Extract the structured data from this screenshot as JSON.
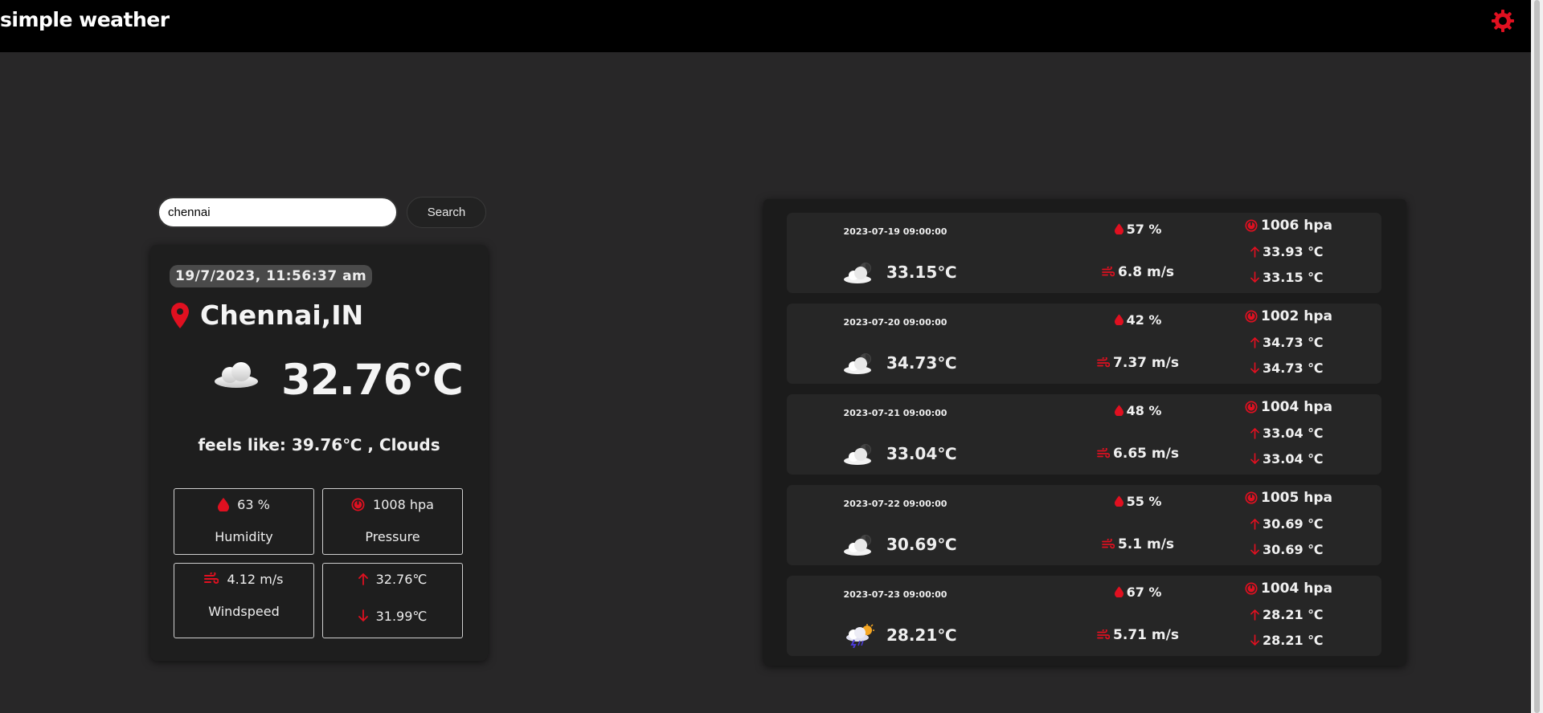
{
  "app": {
    "title": "simple weather",
    "accent_color": "#e01020",
    "settings_icon": "gear-icon"
  },
  "search": {
    "value": "chennai",
    "button_label": "Search"
  },
  "current": {
    "datetime": "19/7/2023, 11:56:37 am",
    "city": "Chennai,IN",
    "icon": "cloud-icon",
    "temperature": "32.76℃",
    "feels_like": "feels like: 39.76℃ , Clouds",
    "humidity": {
      "value": "63 %",
      "label": "Humidity",
      "icon": "droplet-icon"
    },
    "pressure": {
      "value": "1008 hpa",
      "label": "Pressure",
      "icon": "gauge-icon"
    },
    "windspeed": {
      "value": "4.12 m/s",
      "label": "Windspeed",
      "icon": "wind-icon"
    },
    "temp_max": "32.76℃",
    "temp_min": "31.99℃"
  },
  "forecast": [
    {
      "date": "2023-07-19 09:00:00",
      "icon": "cloud-sun-icon",
      "temp": "33.15℃",
      "humidity": "57 %",
      "wind": "6.8 m/s",
      "pressure": "1006 hpa",
      "max": "33.93 ℃",
      "min": "33.15 ℃"
    },
    {
      "date": "2023-07-20 09:00:00",
      "icon": "cloud-sun-icon",
      "temp": "34.73℃",
      "humidity": "42 %",
      "wind": "7.37 m/s",
      "pressure": "1002 hpa",
      "max": "34.73 ℃",
      "min": "34.73 ℃"
    },
    {
      "date": "2023-07-21 09:00:00",
      "icon": "cloud-sun-icon",
      "temp": "33.04℃",
      "humidity": "48 %",
      "wind": "6.65 m/s",
      "pressure": "1004 hpa",
      "max": "33.04 ℃",
      "min": "33.04 ℃"
    },
    {
      "date": "2023-07-22 09:00:00",
      "icon": "cloud-sun-icon",
      "temp": "30.69℃",
      "humidity": "55 %",
      "wind": "5.1 m/s",
      "pressure": "1005 hpa",
      "max": "30.69 ℃",
      "min": "30.69 ℃"
    },
    {
      "date": "2023-07-23 09:00:00",
      "icon": "storm-sun-icon",
      "temp": "28.21℃",
      "humidity": "67 %",
      "wind": "5.71 m/s",
      "pressure": "1004 hpa",
      "max": "28.21 ℃",
      "min": "28.21 ℃"
    }
  ]
}
